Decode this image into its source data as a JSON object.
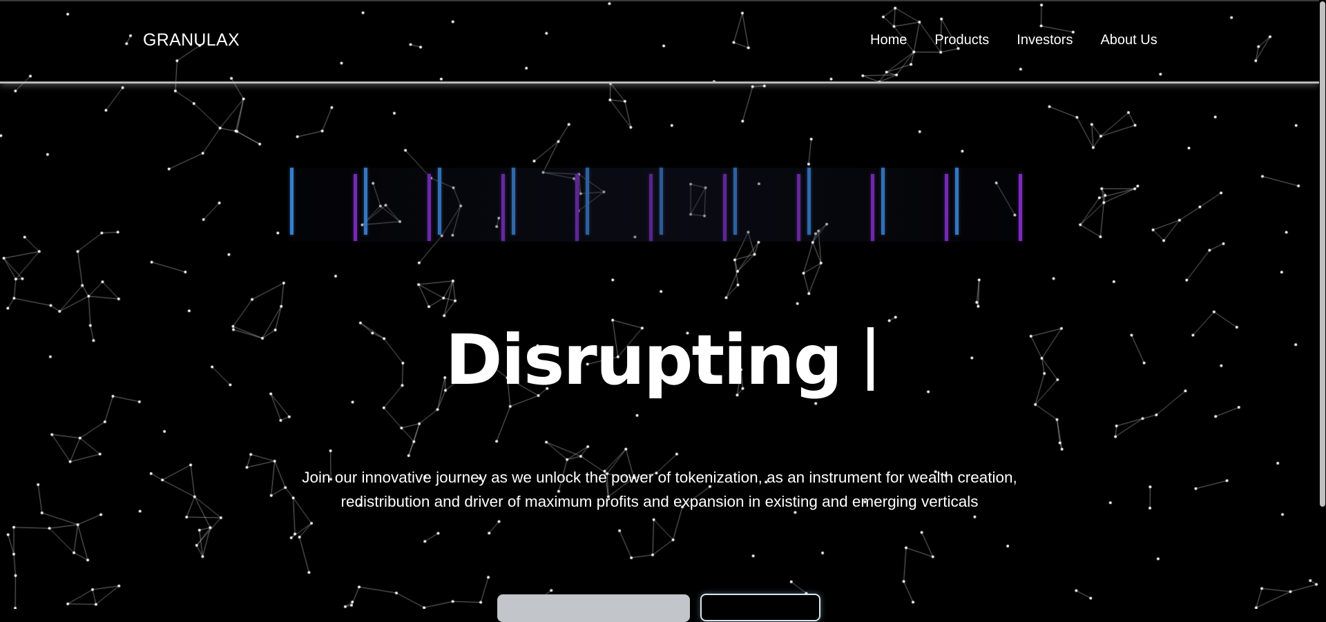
{
  "brand": {
    "name": "GRANULAX"
  },
  "nav": {
    "items": [
      {
        "label": "Home"
      },
      {
        "label": "Products"
      },
      {
        "label": "Investors"
      },
      {
        "label": "About Us"
      }
    ]
  },
  "hero": {
    "headline": "Disrupting",
    "intro": "Join our innovative journey as we unlock the power of tokenization, as an instrument for wealth creation, redistribution and driver of maximum profits and expansion in existing and emerging verticals"
  },
  "colors": {
    "background": "#000000",
    "bar_blue": "#3d8fe8",
    "bar_purple": "#8c2fd6",
    "button_primary": "#c2c6ca"
  },
  "icons": {
    "background": "constellation-particles",
    "bars": "equalizer-bars-icon"
  }
}
